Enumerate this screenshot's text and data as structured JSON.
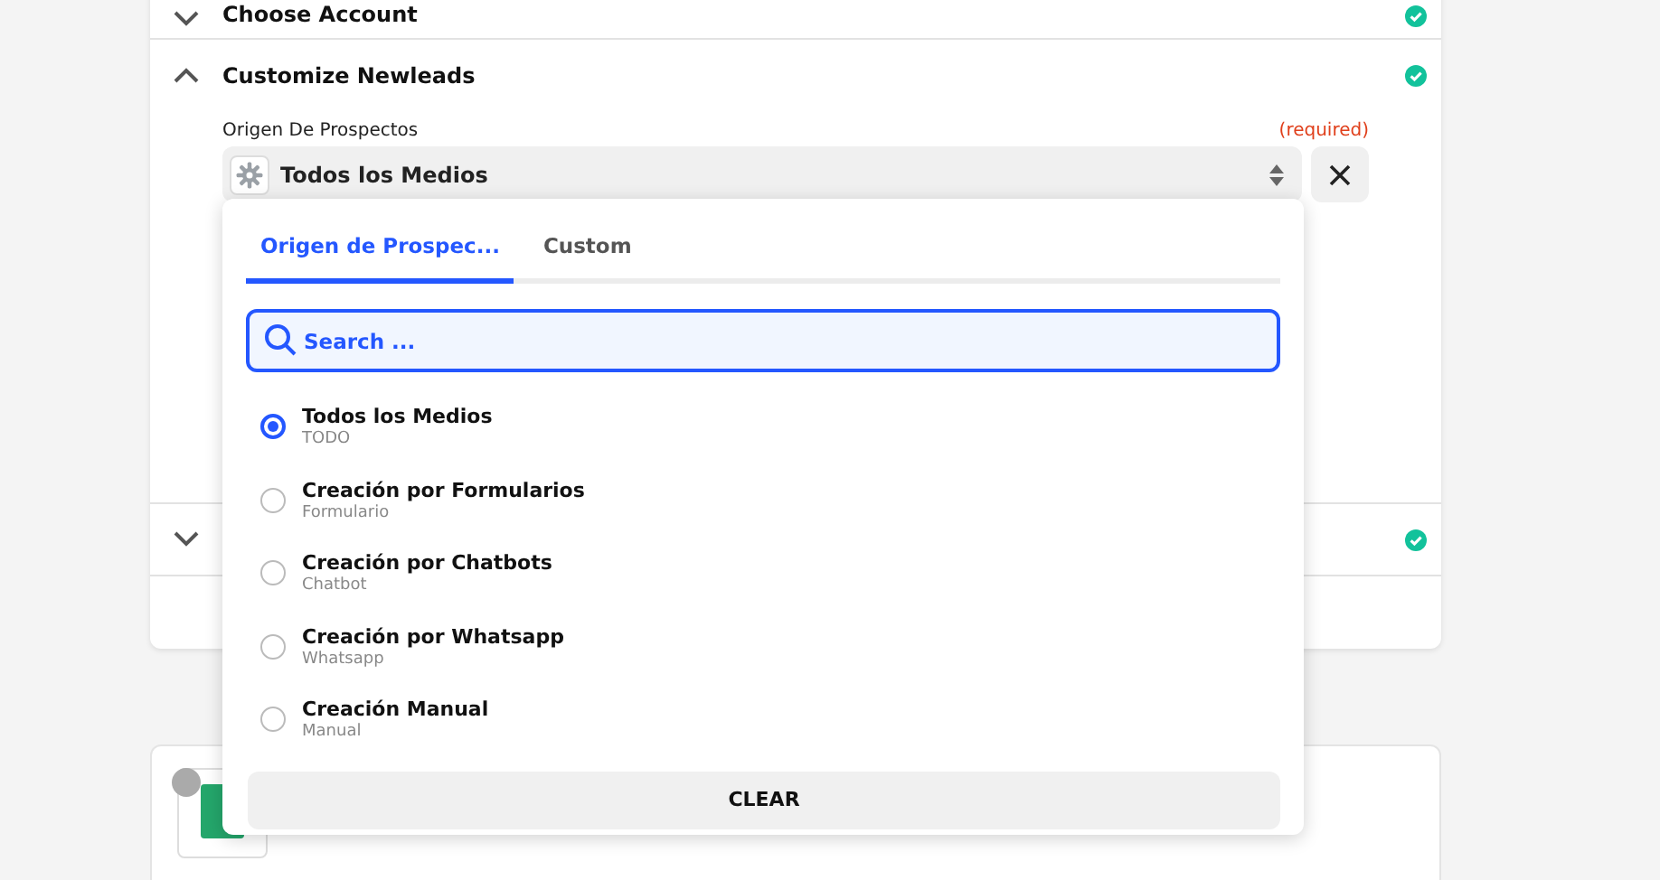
{
  "steps": [
    {
      "title": "Choose Account",
      "expanded": false,
      "complete": true
    },
    {
      "title": "Customize Newleads",
      "expanded": true,
      "complete": true
    },
    {
      "expanded": false,
      "complete": true
    }
  ],
  "field": {
    "label": "Origen De Prospectos",
    "required_note": "(required)",
    "value": "Todos los Medios"
  },
  "dropdown": {
    "tabs": [
      {
        "label": "Origen de Prospec...",
        "selected": true
      },
      {
        "label": "Custom",
        "selected": false
      }
    ],
    "search": {
      "placeholder": "Search ..."
    },
    "options": [
      {
        "label": "Todos los Medios",
        "sublabel": "TODO",
        "selected": true
      },
      {
        "label": "Creación por Formularios",
        "sublabel": "Formulario",
        "selected": false
      },
      {
        "label": "Creación por Chatbots",
        "sublabel": "Chatbot",
        "selected": false
      },
      {
        "label": "Creación por Whatsapp",
        "sublabel": "Whatsapp",
        "selected": false
      },
      {
        "label": "Creación Manual",
        "sublabel": "Manual",
        "selected": false
      }
    ],
    "clear_button": "CLEAR"
  }
}
